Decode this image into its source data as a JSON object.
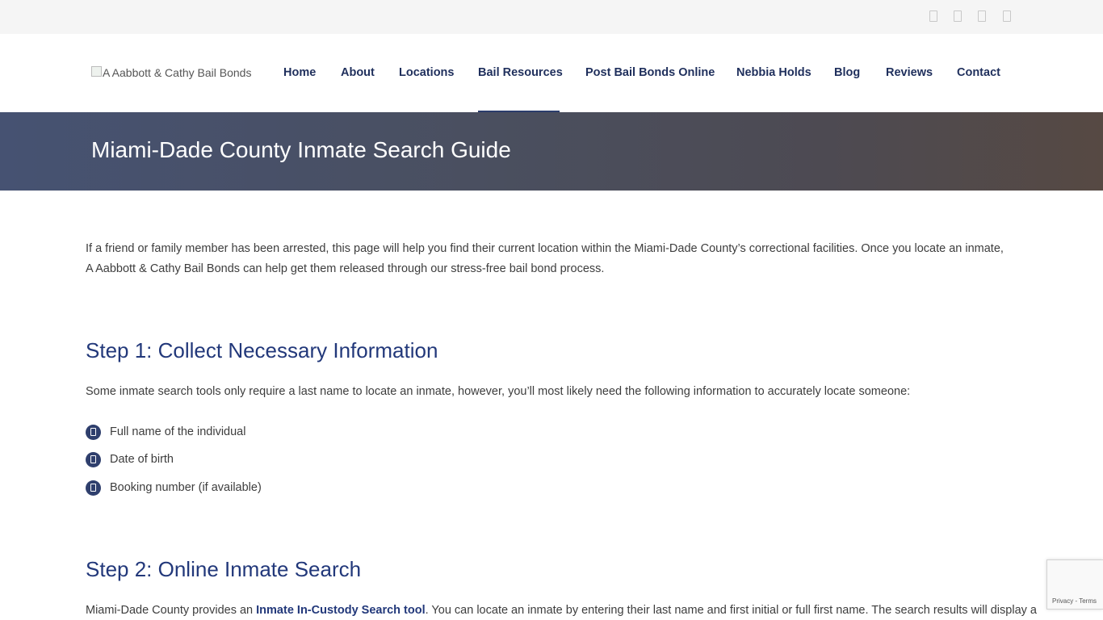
{
  "topbar": {
    "social_icons": [
      "facebook-icon",
      "twitter-icon",
      "linkedin-icon",
      "youtube-icon"
    ]
  },
  "header": {
    "logo_alt": "A Aabbott & Cathy Bail Bonds",
    "nav": [
      {
        "label": "Home"
      },
      {
        "label": "About"
      },
      {
        "label": "Locations"
      },
      {
        "label": "Bail Resources",
        "active": true
      },
      {
        "label": "Post Bail Bonds Online"
      },
      {
        "label": "Nebbia Holds"
      },
      {
        "label": "Blog"
      },
      {
        "label": "Reviews"
      },
      {
        "label": "Contact"
      }
    ]
  },
  "banner": {
    "title": "Miami-Dade County Inmate Search Guide"
  },
  "content": {
    "intro": "If a friend or family member has been arrested, this page will help you find their current location within the Miami-Dade County’s correctional facilities. Once you locate an inmate, A Aabbott & Cathy Bail Bonds can help get them released through our stress-free bail bond process.",
    "step1": {
      "heading": "Step 1: Collect Necessary Information",
      "text": "Some inmate search tools only require a last name to locate an inmate, however, you’ll most likely need the following information to accurately locate someone:",
      "items": [
        "Full name of the individual",
        "Date of birth",
        "Booking number (if available)"
      ]
    },
    "step2": {
      "heading": "Step 2: Online Inmate Search",
      "text_before": "Miami-Dade County provides an ",
      "link": "Inmate In-Custody Search tool",
      "text_after": ". You can locate an inmate by entering their last name and first initial or full first name. The search results will display a"
    }
  },
  "recaptcha": {
    "privacy": "Privacy",
    "separator": " - ",
    "terms": "Terms"
  },
  "colors": {
    "nav_text": "#1f2f5c",
    "heading": "#22387a",
    "bullet": "#2f3f6d",
    "topbar": "#f5f5f5"
  }
}
